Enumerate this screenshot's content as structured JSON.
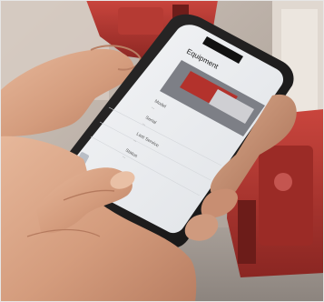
{
  "photo": {
    "screen": {
      "header_title": "Equipment",
      "rows": [
        {
          "label": "Model",
          "value": "..."
        },
        {
          "label": "Serial",
          "value": "..."
        },
        {
          "label": "Last Service",
          "value": "..."
        },
        {
          "label": "Status",
          "value": "..."
        }
      ]
    }
  }
}
